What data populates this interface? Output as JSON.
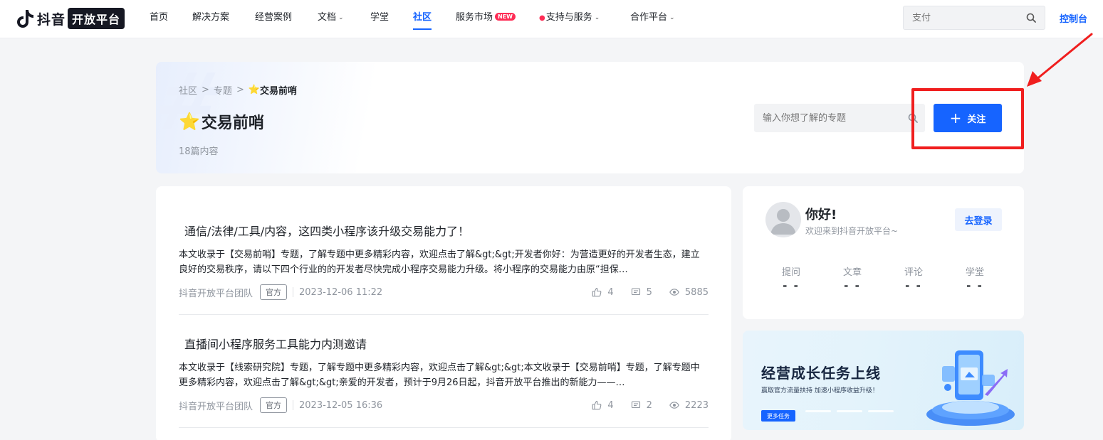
{
  "nav": {
    "brand_a": "抖音",
    "brand_b": "开放平台",
    "items": [
      {
        "label": "首页"
      },
      {
        "label": "解决方案"
      },
      {
        "label": "经营案例"
      },
      {
        "label": "文档"
      },
      {
        "label": "学堂"
      },
      {
        "label": "社区"
      },
      {
        "label": "服务市场"
      },
      {
        "label": "支持与服务"
      },
      {
        "label": "合作平台"
      }
    ],
    "new_badge": "NEW",
    "search_placeholder": "支付",
    "console": "控制台"
  },
  "header": {
    "breadcrumb": [
      "社区",
      "专题",
      "交易前哨"
    ],
    "breadcrumb_sep": ">",
    "title": "交易前哨",
    "count": "18篇内容",
    "search_placeholder": "输入你想了解的专题",
    "follow_label": "关注"
  },
  "articles": [
    {
      "title": "通信/法律/工具/内容，这四类小程序该升级交易能力了！",
      "desc": "本文收录于【交易前哨】专题，了解专题中更多精彩内容，欢迎点击了解&gt;&gt;开发者你好：为营造更好的开发者生态，建立良好的交易秩序，请以下四个行业的的开发者尽快完成小程序交易能力升级。将小程序的交易能力由原“担保…",
      "author": "抖音开放平台团队",
      "tag": "官方",
      "date": "2023-12-06 11:22",
      "likes": "4",
      "comments": "5",
      "views": "5885"
    },
    {
      "title": "直播间小程序服务工具能力内测邀请",
      "desc": "本文收录于【线索研究院】专题，了解专题中更多精彩内容，欢迎点击了解&gt;&gt;本文收录于【交易前哨】专题，了解专题中更多精彩内容，欢迎点击了解&gt;&gt;亲爱的开发者，预计于9月26日起，抖音开放平台推出的新能力——…",
      "author": "抖音开放平台团队",
      "tag": "官方",
      "date": "2023-12-05 16:36",
      "likes": "4",
      "comments": "2",
      "views": "2223"
    }
  ],
  "profile": {
    "hello": "你好!",
    "welcome": "欢迎来到抖音开放平台~",
    "login": "去登录",
    "stats": [
      {
        "label": "提问",
        "value": "- -"
      },
      {
        "label": "文章",
        "value": "- -"
      },
      {
        "label": "评论",
        "value": "- -"
      },
      {
        "label": "学堂",
        "value": "- -"
      }
    ]
  },
  "banner": {
    "title": "经营成长任务上线",
    "subtitle": "赢取官方流量扶持 加速小程序收益升级！",
    "button": "更多任务"
  },
  "colors": {
    "accent": "#1664ff",
    "annotation": "#f01e1e",
    "star": "#f7b500"
  }
}
